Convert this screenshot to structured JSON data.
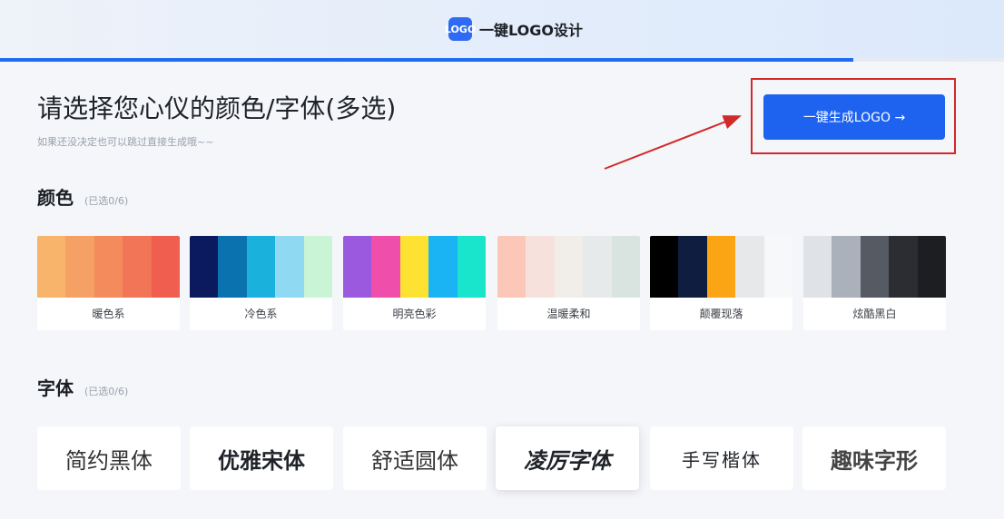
{
  "header": {
    "logo_text": "LOGO",
    "app_name": "一键LOGO设计"
  },
  "progress": {
    "fraction": 0.85,
    "color": "#1f6bf2"
  },
  "page": {
    "title": "请选择您心仪的颜色/字体(多选)",
    "subtitle": "如果还没决定也可以跳过直接生成哦~~"
  },
  "generate_button": {
    "label": "一键生成LOGO →"
  },
  "colors_section": {
    "title": "颜色",
    "count": "(已选0/6)",
    "palettes": [
      {
        "label": "暖色系",
        "swatches": [
          "#f8b46a",
          "#f5a064",
          "#f48b5d",
          "#f27557",
          "#ef5e4e"
        ]
      },
      {
        "label": "冷色系",
        "swatches": [
          "#0b1a5e",
          "#0b72b0",
          "#1ab1dd",
          "#8fdaf2",
          "#c9f5d6"
        ]
      },
      {
        "label": "明亮色彩",
        "swatches": [
          "#9b59e0",
          "#ef4faa",
          "#fde232",
          "#1ab4f4",
          "#18e5cc"
        ]
      },
      {
        "label": "温暖柔和",
        "swatches": [
          "#fbc7b9",
          "#f7e1dc",
          "#f1eeea",
          "#e7eaea",
          "#d9e3e0"
        ]
      },
      {
        "label": "颠覆现落",
        "swatches": [
          "#000000",
          "#0f1e40",
          "#fba515",
          "#e6e8ea",
          "#f7f8fa"
        ]
      },
      {
        "label": "炫酷黑白",
        "swatches": [
          "#dfe3e8",
          "#aab1bb",
          "#555a63",
          "#2b2d33",
          "#1d1e21"
        ]
      }
    ]
  },
  "fonts_section": {
    "title": "字体",
    "count": "(已选0/6)",
    "fonts": [
      {
        "label": "简约黑体"
      },
      {
        "label": "优雅宋体"
      },
      {
        "label": "舒适圆体"
      },
      {
        "label": "凌厉字体"
      },
      {
        "label": "手写楷体"
      },
      {
        "label": "趣味字形"
      }
    ]
  },
  "colors": {
    "accent": "#1e62f0",
    "highlight": "#d22a2a",
    "background": "#f4f6fa"
  }
}
